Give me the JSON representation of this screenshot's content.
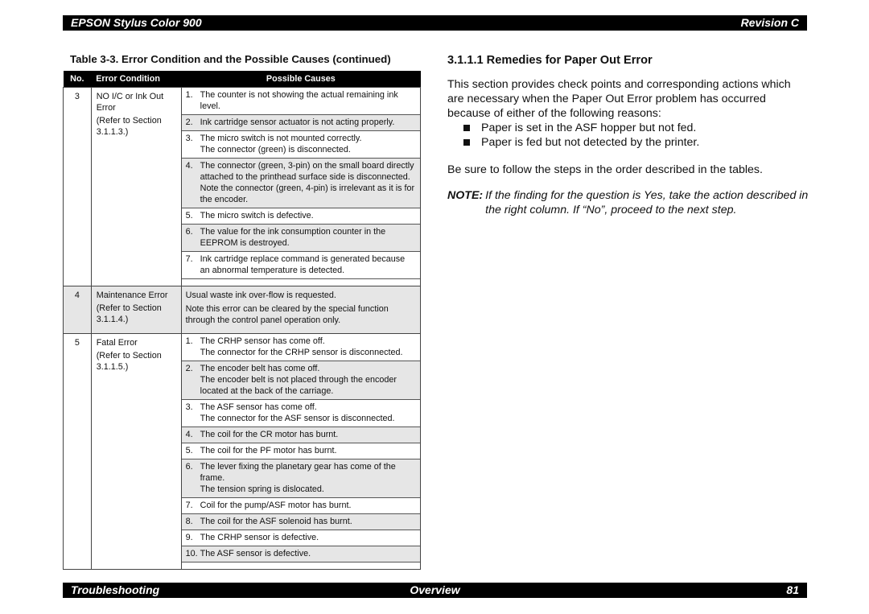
{
  "header": {
    "title": "EPSON Stylus Color 900",
    "revision": "Revision C"
  },
  "footer": {
    "left": "Troubleshooting",
    "center": "Overview",
    "page": "81"
  },
  "table": {
    "caption": "Table 3-3.  Error Condition and the Possible Causes (continued)",
    "columns": [
      "No.",
      "Error Condition",
      "Possible Causes"
    ],
    "rows": [
      {
        "no": "3",
        "condition": [
          "NO I/C or Ink Out Error",
          "(Refer to Section 3.1.1.3.)"
        ],
        "causes": [
          {
            "num": "1.",
            "lines": [
              "The counter is not showing the actual remaining ink level."
            ]
          },
          {
            "num": "2.",
            "lines": [
              "Ink cartridge sensor actuator is not acting properly."
            ]
          },
          {
            "num": "3.",
            "lines": [
              "The micro switch is not mounted correctly.",
              "The connector (green) is disconnected."
            ]
          },
          {
            "num": "4.",
            "lines": [
              "The connector (green, 3-pin) on the small board directly attached to the printhead surface side is disconnected. Note the connector (green, 4-pin) is irrelevant as it is for the encoder."
            ]
          },
          {
            "num": "5.",
            "lines": [
              "The micro switch is defective."
            ]
          },
          {
            "num": "6.",
            "lines": [
              "The value for the ink consumption counter in the EEPROM is destroyed."
            ]
          },
          {
            "num": "7.",
            "lines": [
              "Ink cartridge replace command is generated because an abnormal temperature is detected."
            ]
          }
        ]
      },
      {
        "no": "4",
        "condition": [
          "Maintenance Error",
          "(Refer to Section 3.1.1.4.)"
        ],
        "text": [
          "Usual waste ink over-flow is requested.",
          "Note this error can be cleared by the special function through the control panel operation only."
        ]
      },
      {
        "no": "5",
        "condition": [
          "Fatal Error",
          "(Refer to Section 3.1.1.5.)"
        ],
        "causes": [
          {
            "num": "1.",
            "lines": [
              "The CRHP sensor has come off.",
              "The connector for the CRHP sensor is disconnected."
            ]
          },
          {
            "num": "2.",
            "lines": [
              "The encoder belt has come off.",
              "The encoder belt is not placed through the encoder located at the back of the carriage."
            ]
          },
          {
            "num": "3.",
            "lines": [
              "The ASF sensor has come off.",
              "The connector for the ASF sensor is disconnected."
            ]
          },
          {
            "num": "4.",
            "lines": [
              "The coil for the CR motor has burnt."
            ]
          },
          {
            "num": "5.",
            "lines": [
              "The coil for the PF motor has burnt."
            ]
          },
          {
            "num": "6.",
            "lines": [
              "The lever fixing the planetary gear has come of the frame.",
              "The tension spring is dislocated."
            ]
          },
          {
            "num": "7.",
            "lines": [
              "Coil for the pump/ASF motor has burnt."
            ]
          },
          {
            "num": "8.",
            "lines": [
              "The coil for the ASF solenoid has burnt."
            ]
          },
          {
            "num": "9.",
            "lines": [
              "The CRHP sensor is defective."
            ]
          },
          {
            "num": "10.",
            "lines": [
              "The ASF sensor is defective."
            ]
          }
        ]
      }
    ]
  },
  "section": {
    "title": "3.1.1.1  Remedies for Paper Out Error",
    "intro": "This section provides check points and corresponding actions which are necessary when the Paper Out Error problem has occurred because of either of the following reasons:",
    "reasons": [
      "Paper is set in the ASF hopper but not fed.",
      "Paper is fed but not detected by the printer."
    ],
    "order_note": "Be sure to follow the steps in the order described in the tables.",
    "note_label": "NOTE:",
    "note_text": "If the finding for the question is Yes, take the action described in the right column. If “No”, proceed to the next step."
  }
}
